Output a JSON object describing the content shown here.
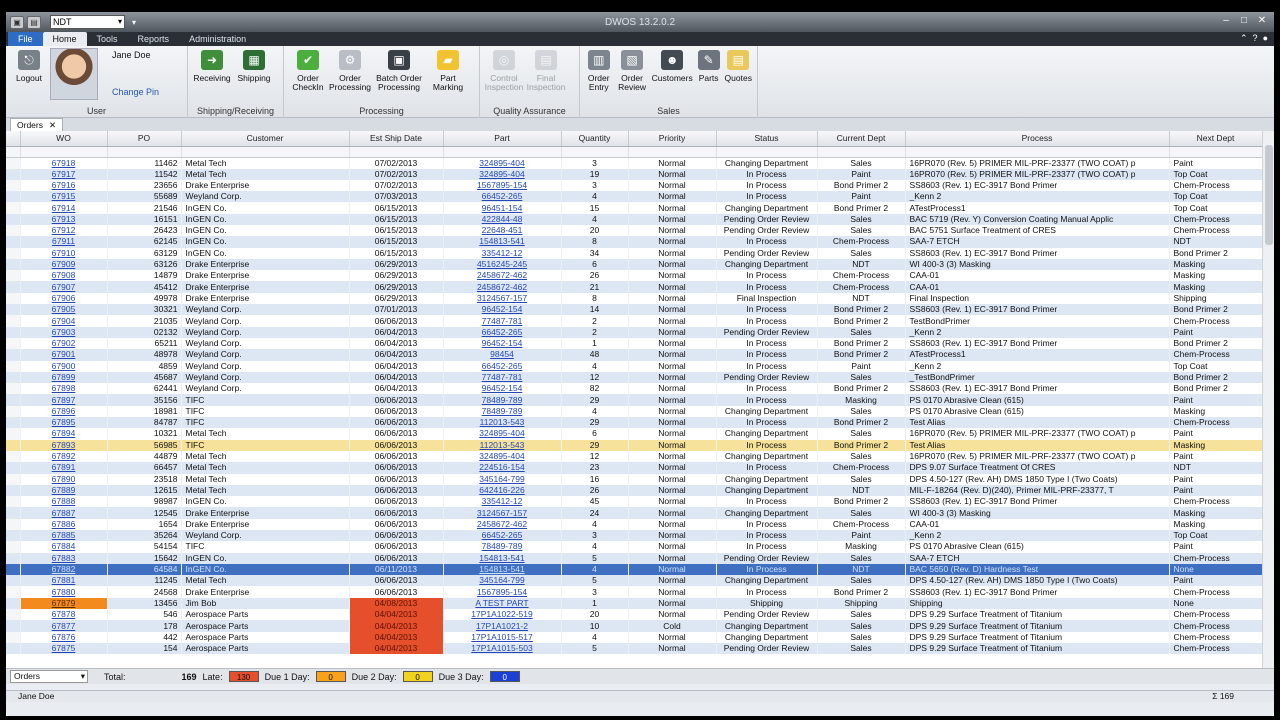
{
  "window": {
    "title": "DWOS 13.2.0.2",
    "dept": "NDT"
  },
  "ribbon_tabs": [
    "File",
    "Home",
    "Tools",
    "Reports",
    "Administration"
  ],
  "ribbon": {
    "user": {
      "logout": "Logout",
      "name": "Jane Doe",
      "change_pin": "Change Pin",
      "group": "User"
    },
    "shipping": {
      "receiving": "Receiving",
      "shipping": "Shipping",
      "group": "Shipping/Receiving"
    },
    "processing": {
      "order_checkin": "Order CheckIn",
      "order_processing": "Order Processing",
      "batch": "Batch Order Processing",
      "part_marking": "Part Marking",
      "group": "Processing"
    },
    "quality": {
      "control": "Control Inspection",
      "final": "Final Inspection",
      "group": "Quality Assurance"
    },
    "sales": {
      "order_entry": "Order Entry",
      "order_review": "Order Review",
      "customers": "Customers",
      "parts": "Parts",
      "quotes": "Quotes",
      "group": "Sales"
    }
  },
  "doc_tab": "Orders",
  "columns": [
    "WO",
    "PO",
    "Customer",
    "Est Ship Date",
    "Part",
    "Quantity",
    "Priority",
    "Status",
    "Current Dept",
    "Process",
    "Next Dept"
  ],
  "rows": [
    [
      "67918",
      "11462",
      "Metal Tech",
      "07/02/2013",
      "324895-404",
      "3",
      "Normal",
      "Changing Department",
      "Sales",
      "16PR070 (Rev. 5) PRIMER MIL-PRF-23377 (TWO COAT) p",
      "Paint"
    ],
    [
      "67917",
      "11542",
      "Metal Tech",
      "07/02/2013",
      "324895-404",
      "19",
      "Normal",
      "In Process",
      "Paint",
      "16PR070 (Rev. 5) PRIMER MIL-PRF-23377 (TWO COAT) p",
      "Top Coat"
    ],
    [
      "67916",
      "23656",
      "Drake Enterprise",
      "07/02/2013",
      "1567895-154",
      "3",
      "Normal",
      "In Process",
      "Bond Primer 2",
      "SS8603 (Rev. 1) EC-3917 Bond Primer",
      "Chem-Process"
    ],
    [
      "67915",
      "55689",
      "Weyland Corp.",
      "07/03/2013",
      "66452-265",
      "4",
      "Normal",
      "In Process",
      "Paint",
      "_Kenn 2",
      "Top Coat"
    ],
    [
      "67914",
      "21546",
      "InGEN Co.",
      "06/15/2013",
      "96451-154",
      "15",
      "Normal",
      "Changing Department",
      "Bond Primer 2",
      "ATestProcess1",
      "Top Coat"
    ],
    [
      "67913",
      "16151",
      "InGEN Co.",
      "06/15/2013",
      "422844-48",
      "4",
      "Normal",
      "Pending Order Review",
      "Sales",
      "BAC 5719 (Rev. Y) Conversion Coating Manual Applic",
      "Chem-Process"
    ],
    [
      "67912",
      "26423",
      "InGEN Co.",
      "06/15/2013",
      "22648-451",
      "20",
      "Normal",
      "Pending Order Review",
      "Sales",
      "BAC 5751 Surface Treatment of CRES",
      "Chem-Process"
    ],
    [
      "67911",
      "62145",
      "InGEN Co.",
      "06/15/2013",
      "154813-541",
      "8",
      "Normal",
      "In Process",
      "Chem-Process",
      "SAA-7 ETCH",
      "NDT"
    ],
    [
      "67910",
      "63129",
      "InGEN Co.",
      "06/15/2013",
      "335412-12",
      "34",
      "Normal",
      "Pending Order Review",
      "Sales",
      "SS8603 (Rev. 1) EC-3917 Bond Primer",
      "Bond Primer 2"
    ],
    [
      "67909",
      "63126",
      "Drake Enterprise",
      "06/29/2013",
      "4516245-245",
      "6",
      "Normal",
      "Changing Department",
      "NDT",
      "WI 400-3 (3) Masking",
      "Masking"
    ],
    [
      "67908",
      "14879",
      "Drake Enterprise",
      "06/29/2013",
      "2458672-462",
      "26",
      "Normal",
      "In Process",
      "Chem-Process",
      "CAA-01",
      "Masking"
    ],
    [
      "67907",
      "45412",
      "Drake Enterprise",
      "06/29/2013",
      "2458672-462",
      "21",
      "Normal",
      "In Process",
      "Chem-Process",
      "CAA-01",
      "Masking"
    ],
    [
      "67906",
      "49978",
      "Drake Enterprise",
      "06/29/2013",
      "3124567-157",
      "8",
      "Normal",
      "Final Inspection",
      "NDT",
      "Final Inspection",
      "Shipping"
    ],
    [
      "67905",
      "30321",
      "Weyland Corp.",
      "07/01/2013",
      "96452-154",
      "14",
      "Normal",
      "In Process",
      "Bond Primer 2",
      "SS8603 (Rev. 1) EC-3917 Bond Primer",
      "Bond Primer 2"
    ],
    [
      "67904",
      "21035",
      "Weyland Corp.",
      "06/06/2013",
      "77487-781",
      "2",
      "Normal",
      "In Process",
      "Bond Primer 2",
      "TestBondPrimer",
      "Chem-Process"
    ],
    [
      "67903",
      "02132",
      "Weyland Corp.",
      "06/04/2013",
      "66452-265",
      "2",
      "Normal",
      "Pending Order Review",
      "Sales",
      "_Kenn 2",
      "Paint"
    ],
    [
      "67902",
      "65211",
      "Weyland Corp.",
      "06/04/2013",
      "96452-154",
      "1",
      "Normal",
      "In Process",
      "Bond Primer 2",
      "SS8603 (Rev. 1) EC-3917 Bond Primer",
      "Bond Primer 2"
    ],
    [
      "67901",
      "48978",
      "Weyland Corp.",
      "06/04/2013",
      "98454",
      "48",
      "Normal",
      "In Process",
      "Bond Primer 2",
      "ATestProcess1",
      "Chem-Process"
    ],
    [
      "67900",
      "4859",
      "Weyland Corp.",
      "06/04/2013",
      "66452-265",
      "4",
      "Normal",
      "In Process",
      "Paint",
      "_Kenn 2",
      "Top Coat"
    ],
    [
      "67899",
      "45687",
      "Weyland Corp.",
      "06/04/2013",
      "77487-781",
      "12",
      "Normal",
      "Pending Order Review",
      "Sales",
      "_TestBondPrimer",
      "Bond Primer 2"
    ],
    [
      "67898",
      "62441",
      "Weyland Corp.",
      "06/04/2013",
      "96452-154",
      "82",
      "Normal",
      "In Process",
      "Bond Primer 2",
      "SS8603 (Rev. 1) EC-3917 Bond Primer",
      "Bond Primer 2"
    ],
    [
      "67897",
      "35156",
      "TIFC",
      "06/06/2013",
      "78489-789",
      "29",
      "Normal",
      "In Process",
      "Masking",
      "PS 0170  Abrasive Clean (615)",
      "Paint"
    ],
    [
      "67896",
      "18981",
      "TIFC",
      "06/06/2013",
      "78489-789",
      "4",
      "Normal",
      "Changing Department",
      "Sales",
      "PS 0170  Abrasive Clean (615)",
      "Masking"
    ],
    [
      "67895",
      "84787",
      "TIFC",
      "06/06/2013",
      "112013-543",
      "29",
      "Normal",
      "In Process",
      "Bond Primer 2",
      "Test Alias",
      "Chem-Process"
    ],
    [
      "67894",
      "10321",
      "Metal Tech",
      "06/06/2013",
      "324895-404",
      "6",
      "Normal",
      "Changing Department",
      "Sales",
      "16PR070 (Rev. 5) PRIMER MIL-PRF-23377 (TWO COAT) p",
      "Paint"
    ],
    [
      "67893",
      "56985",
      "TIFC",
      "06/06/2013",
      "112013-543",
      "29",
      "Normal",
      "In Process",
      "Bond Primer 2",
      "Test Alias",
      "Masking"
    ],
    [
      "67892",
      "44879",
      "Metal Tech",
      "06/06/2013",
      "324895-404",
      "12",
      "Normal",
      "Changing Department",
      "Sales",
      "16PR070 (Rev. 5) PRIMER MIL-PRF-23377 (TWO COAT) p",
      "Paint"
    ],
    [
      "67891",
      "66457",
      "Metal Tech",
      "06/06/2013",
      "224516-154",
      "23",
      "Normal",
      "In Process",
      "Chem-Process",
      "DPS 9.07 Surface Treatment Of CRES",
      "NDT"
    ],
    [
      "67890",
      "23518",
      "Metal Tech",
      "06/06/2013",
      "345164-799",
      "16",
      "Normal",
      "Changing Department",
      "Sales",
      "DPS 4.50-127 (Rev. AH) DMS 1850 Type I (Two Coats)",
      "Paint"
    ],
    [
      "67889",
      "12615",
      "Metal Tech",
      "06/06/2013",
      "642416-226",
      "26",
      "Normal",
      "Changing Department",
      "NDT",
      "MIL-F-18264 (Rev. D)(240), Primer MIL-PRF-23377, T",
      "Paint"
    ],
    [
      "67888",
      "98987",
      "InGEN Co.",
      "06/06/2013",
      "335412-12",
      "45",
      "Normal",
      "In Process",
      "Bond Primer 2",
      "SS8603 (Rev. 1) EC-3917 Bond Primer",
      "Chem-Process"
    ],
    [
      "67887",
      "12545",
      "Drake Enterprise",
      "06/06/2013",
      "3124567-157",
      "24",
      "Normal",
      "Changing Department",
      "Sales",
      "WI 400-3 (3)  Masking",
      "Masking"
    ],
    [
      "67886",
      "1654",
      "Drake Enterprise",
      "06/06/2013",
      "2458672-462",
      "4",
      "Normal",
      "In Process",
      "Chem-Process",
      "CAA-01",
      "Masking"
    ],
    [
      "67885",
      "35264",
      "Weyland Corp.",
      "06/06/2013",
      "66452-265",
      "3",
      "Normal",
      "In Process",
      "Paint",
      "_Kenn 2",
      "Top Coat"
    ],
    [
      "67884",
      "54154",
      "TIFC",
      "06/06/2013",
      "78489-789",
      "4",
      "Normal",
      "In Process",
      "Masking",
      "PS 0170  Abrasive Clean (615)",
      "Paint"
    ],
    [
      "67883",
      "15642",
      "InGEN Co.",
      "06/06/2013",
      "154813-541",
      "5",
      "Normal",
      "Pending Order Review",
      "Sales",
      "SAA-7 ETCH",
      "Chem-Process"
    ],
    [
      "67882",
      "64584",
      "InGEN Co.",
      "06/11/2013",
      "154813-541",
      "4",
      "Normal",
      "In Process",
      "NDT",
      "BAC 5650 (Rev. D) Hardness Test",
      "None"
    ],
    [
      "67881",
      "11245",
      "Metal Tech",
      "06/06/2013",
      "345164-799",
      "5",
      "Normal",
      "Changing Department",
      "Sales",
      "DPS 4.50-127 (Rev. AH) DMS 1850 Type I (Two Coats)",
      "Paint"
    ],
    [
      "67880",
      "24568",
      "Drake Enterprise",
      "06/06/2013",
      "1567895-154",
      "3",
      "Normal",
      "In Process",
      "Bond Primer 2",
      "SS8603 (Rev. 1) EC-3917 Bond Primer",
      "Chem-Process"
    ],
    [
      "67879",
      "13456",
      "Jim Bob",
      "04/08/2013",
      "A TEST PART",
      "1",
      "Normal",
      "Shipping",
      "Shipping",
      "Shipping",
      "None"
    ],
    [
      "67878",
      "546",
      "Aerospace Parts",
      "04/04/2013",
      "17P1A1022-519",
      "20",
      "Normal",
      "Pending Order Review",
      "Sales",
      "DPS 9.29 Surface Treatment of Titanium",
      "Chem-Process"
    ],
    [
      "67877",
      "178",
      "Aerospace Parts",
      "04/04/2013",
      "17P1A1021-2",
      "10",
      "Cold",
      "Changing Department",
      "Sales",
      "DPS 9.29 Surface Treatment of Titanium",
      "Chem-Process"
    ],
    [
      "67876",
      "442",
      "Aerospace Parts",
      "04/04/2013",
      "17P1A1015-517",
      "4",
      "Normal",
      "Changing Department",
      "Sales",
      "DPS 9.29 Surface Treatment of Titanium",
      "Chem-Process"
    ],
    [
      "67875",
      "154",
      "Aerospace Parts",
      "04/04/2013",
      "17P1A1015-503",
      "5",
      "Normal",
      "Pending Order Review",
      "Sales",
      "DPS 9.29 Surface Treatment of Titanium",
      "Chem-Process"
    ]
  ],
  "row_flags": {
    "highlight": [
      "67893"
    ],
    "selected": [
      "67882"
    ],
    "late": [
      "67879",
      "67878",
      "67877",
      "67876",
      "67875"
    ],
    "wo_late": [
      "67879"
    ]
  },
  "summary": {
    "view": "Orders",
    "total_label": "Total:",
    "total": "169",
    "late_label": "Late:",
    "late": "130",
    "due1_label": "Due 1 Day:",
    "due1": "0",
    "due2_label": "Due 2 Day:",
    "due2": "0",
    "due3_label": "Due 3 Day:",
    "due3": "0"
  },
  "status": {
    "user": "Jane Doe",
    "count": "169"
  },
  "colors": {
    "accent": "#2d6bc4",
    "late": "#e64f2c",
    "due1": "#f7a21a",
    "due2": "#f3d21c",
    "due3": "#1c3fd6",
    "selected": "#3e6fc0"
  }
}
